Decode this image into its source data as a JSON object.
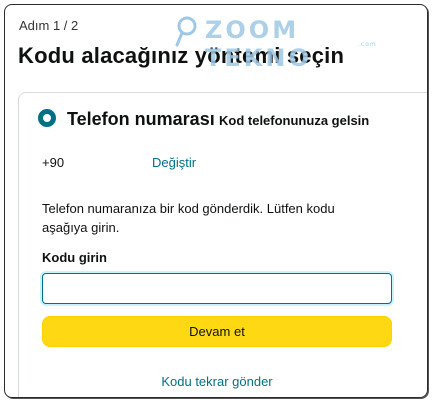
{
  "header": {
    "step": "Adım 1 / 2",
    "title": "Kodu alacağınız yöntemi seçin"
  },
  "watermark": {
    "text": "ZOOM TEKNO",
    "sub": ".com"
  },
  "option": {
    "title": "Telefon numarası",
    "description": "Kod telefonunuza gelsin",
    "selected": true,
    "phone_prefix": "+90",
    "change_label": "Değiştir",
    "info": "Telefon numaranıza bir kod gönderdik. Lütfen kodu aşağıya girin.",
    "code_label": "Kodu girin",
    "code_value": "",
    "continue_label": "Devam et",
    "resend_label": "Kodu tekrar gönder"
  },
  "colors": {
    "accent": "#007185",
    "button": "#ffd814",
    "watermark": "#9fc8e6"
  }
}
